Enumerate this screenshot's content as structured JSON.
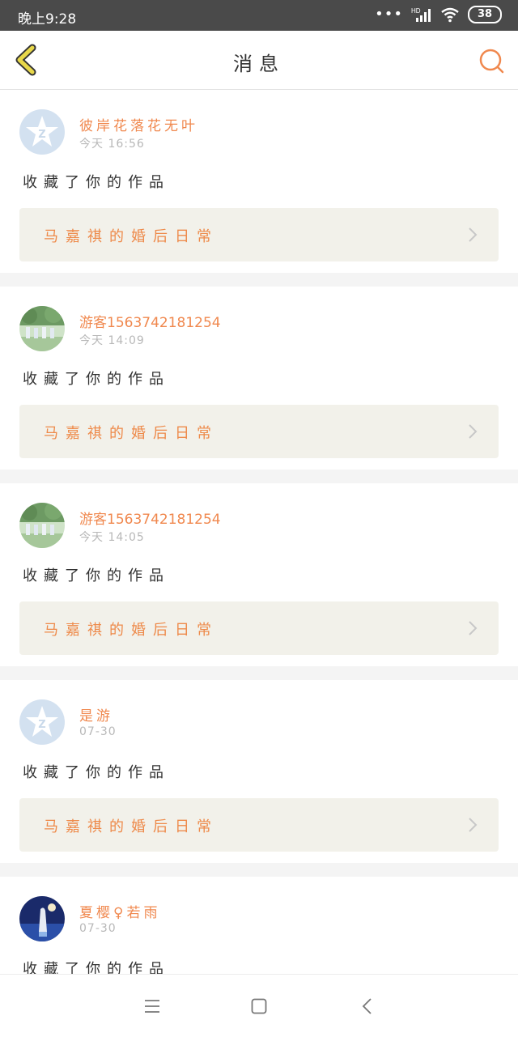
{
  "status_bar": {
    "time": "晚上9:28",
    "signal_label": "HD",
    "battery": "38"
  },
  "header": {
    "title": "消息"
  },
  "messages": [
    {
      "username": "彼岸花落花无叶",
      "time": "今天 16:56",
      "action": "收藏了你的作品",
      "work_title": "马嘉祺的婚后日常",
      "avatar": "default"
    },
    {
      "username": "游客1563742181254",
      "time": "今天 14:09",
      "action": "收藏了你的作品",
      "work_title": "马嘉祺的婚后日常",
      "avatar": "photo-group"
    },
    {
      "username": "游客1563742181254",
      "time": "今天 14:05",
      "action": "收藏了你的作品",
      "work_title": "马嘉祺的婚后日常",
      "avatar": "photo-group"
    },
    {
      "username": "是游",
      "time": "07-30",
      "action": "收藏了你的作品",
      "work_title": "马嘉祺的婚后日常",
      "avatar": "default"
    },
    {
      "username": "夏樱♀若雨",
      "time": "07-30",
      "action": "收藏了你的作品",
      "work_title": "",
      "avatar": "photo-night"
    }
  ],
  "colors": {
    "accent": "#f0884e",
    "back_icon": "#e8d84a",
    "status_bg": "#4a4a4a"
  }
}
